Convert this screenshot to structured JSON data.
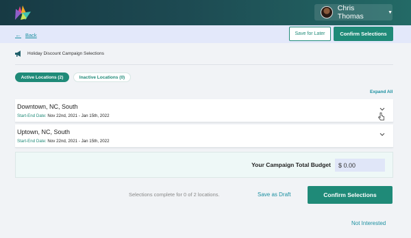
{
  "header": {
    "user_name": "Chris Thomas"
  },
  "actions": {
    "back_label": "Back",
    "save_later_label": "Save for Later",
    "confirm_label": "Confirm Selections"
  },
  "page": {
    "title": "Holiday Discount Campaign Selections"
  },
  "tabs": [
    {
      "label": "Active Locations (2)",
      "active": true
    },
    {
      "label": "Inactive Locations (0)",
      "active": false
    }
  ],
  "expand_all_label": "Expand All",
  "locations": [
    {
      "name": "Downtown, NC, South",
      "date_label": "Start-End Date:",
      "dates": "Nov 22nd, 2021 - Jan 15th, 2022"
    },
    {
      "name": "Uptown, NC, South",
      "date_label": "Start-End Date:",
      "dates": "Nov 22nd, 2021 - Jan 15th, 2022"
    }
  ],
  "budget": {
    "label": "Your Campaign Total Budget",
    "value": "$ 0.00"
  },
  "footer": {
    "status_text": "Selections complete for 0 of 2 locations.",
    "save_draft_label": "Save as Draft",
    "confirm_label": "Confirm Selections",
    "not_interested_label": "Not Interested"
  },
  "colors": {
    "accent": "#1f8a78",
    "link": "#1a8fa0",
    "header_dark": "#173a44"
  },
  "icons": [
    "logo-icon",
    "avatar",
    "caret-down-icon",
    "back-arrow-icon",
    "megaphone-icon",
    "chevron-down-icon",
    "pointer-cursor-icon"
  ]
}
